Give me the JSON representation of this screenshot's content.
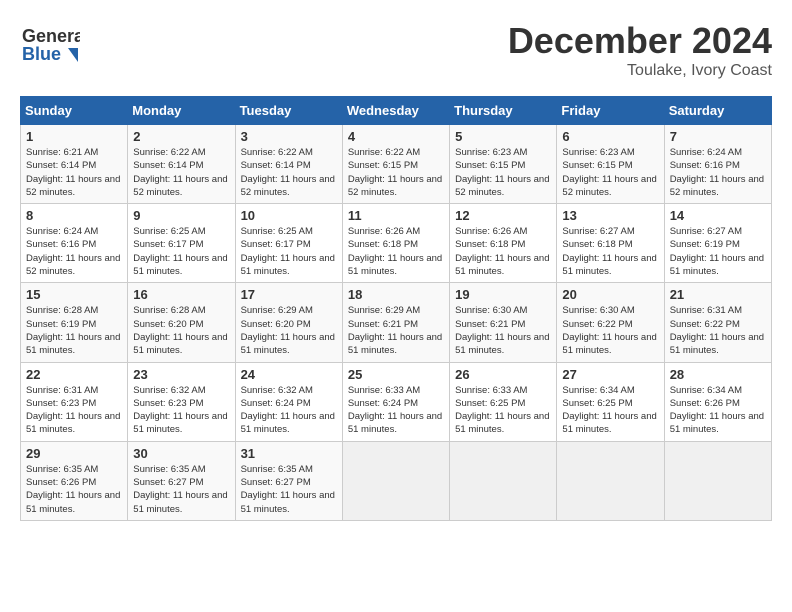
{
  "header": {
    "logo_line1": "General",
    "logo_line2": "Blue",
    "title": "December 2024",
    "subtitle": "Toulake, Ivory Coast"
  },
  "calendar": {
    "days_of_week": [
      "Sunday",
      "Monday",
      "Tuesday",
      "Wednesday",
      "Thursday",
      "Friday",
      "Saturday"
    ],
    "weeks": [
      [
        {
          "day": "",
          "info": ""
        },
        {
          "day": "2",
          "info": "Sunrise: 6:22 AM\nSunset: 6:14 PM\nDaylight: 11 hours\nand 52 minutes."
        },
        {
          "day": "3",
          "info": "Sunrise: 6:22 AM\nSunset: 6:14 PM\nDaylight: 11 hours\nand 52 minutes."
        },
        {
          "day": "4",
          "info": "Sunrise: 6:22 AM\nSunset: 6:15 PM\nDaylight: 11 hours\nand 52 minutes."
        },
        {
          "day": "5",
          "info": "Sunrise: 6:23 AM\nSunset: 6:15 PM\nDaylight: 11 hours\nand 52 minutes."
        },
        {
          "day": "6",
          "info": "Sunrise: 6:23 AM\nSunset: 6:15 PM\nDaylight: 11 hours\nand 52 minutes."
        },
        {
          "day": "7",
          "info": "Sunrise: 6:24 AM\nSunset: 6:16 PM\nDaylight: 11 hours\nand 52 minutes."
        }
      ],
      [
        {
          "day": "1",
          "info": "Sunrise: 6:21 AM\nSunset: 6:14 PM\nDaylight: 11 hours\nand 52 minutes."
        },
        {
          "day": "",
          "info": ""
        },
        {
          "day": "",
          "info": ""
        },
        {
          "day": "",
          "info": ""
        },
        {
          "day": "",
          "info": ""
        },
        {
          "day": "",
          "info": ""
        },
        {
          "day": ""
        }
      ],
      [
        {
          "day": "8",
          "info": "Sunrise: 6:24 AM\nSunset: 6:16 PM\nDaylight: 11 hours\nand 52 minutes."
        },
        {
          "day": "9",
          "info": "Sunrise: 6:25 AM\nSunset: 6:17 PM\nDaylight: 11 hours\nand 51 minutes."
        },
        {
          "day": "10",
          "info": "Sunrise: 6:25 AM\nSunset: 6:17 PM\nDaylight: 11 hours\nand 51 minutes."
        },
        {
          "day": "11",
          "info": "Sunrise: 6:26 AM\nSunset: 6:18 PM\nDaylight: 11 hours\nand 51 minutes."
        },
        {
          "day": "12",
          "info": "Sunrise: 6:26 AM\nSunset: 6:18 PM\nDaylight: 11 hours\nand 51 minutes."
        },
        {
          "day": "13",
          "info": "Sunrise: 6:27 AM\nSunset: 6:18 PM\nDaylight: 11 hours\nand 51 minutes."
        },
        {
          "day": "14",
          "info": "Sunrise: 6:27 AM\nSunset: 6:19 PM\nDaylight: 11 hours\nand 51 minutes."
        }
      ],
      [
        {
          "day": "15",
          "info": "Sunrise: 6:28 AM\nSunset: 6:19 PM\nDaylight: 11 hours\nand 51 minutes."
        },
        {
          "day": "16",
          "info": "Sunrise: 6:28 AM\nSunset: 6:20 PM\nDaylight: 11 hours\nand 51 minutes."
        },
        {
          "day": "17",
          "info": "Sunrise: 6:29 AM\nSunset: 6:20 PM\nDaylight: 11 hours\nand 51 minutes."
        },
        {
          "day": "18",
          "info": "Sunrise: 6:29 AM\nSunset: 6:21 PM\nDaylight: 11 hours\nand 51 minutes."
        },
        {
          "day": "19",
          "info": "Sunrise: 6:30 AM\nSunset: 6:21 PM\nDaylight: 11 hours\nand 51 minutes."
        },
        {
          "day": "20",
          "info": "Sunrise: 6:30 AM\nSunset: 6:22 PM\nDaylight: 11 hours\nand 51 minutes."
        },
        {
          "day": "21",
          "info": "Sunrise: 6:31 AM\nSunset: 6:22 PM\nDaylight: 11 hours\nand 51 minutes."
        }
      ],
      [
        {
          "day": "22",
          "info": "Sunrise: 6:31 AM\nSunset: 6:23 PM\nDaylight: 11 hours\nand 51 minutes."
        },
        {
          "day": "23",
          "info": "Sunrise: 6:32 AM\nSunset: 6:23 PM\nDaylight: 11 hours\nand 51 minutes."
        },
        {
          "day": "24",
          "info": "Sunrise: 6:32 AM\nSunset: 6:24 PM\nDaylight: 11 hours\nand 51 minutes."
        },
        {
          "day": "25",
          "info": "Sunrise: 6:33 AM\nSunset: 6:24 PM\nDaylight: 11 hours\nand 51 minutes."
        },
        {
          "day": "26",
          "info": "Sunrise: 6:33 AM\nSunset: 6:25 PM\nDaylight: 11 hours\nand 51 minutes."
        },
        {
          "day": "27",
          "info": "Sunrise: 6:34 AM\nSunset: 6:25 PM\nDaylight: 11 hours\nand 51 minutes."
        },
        {
          "day": "28",
          "info": "Sunrise: 6:34 AM\nSunset: 6:26 PM\nDaylight: 11 hours\nand 51 minutes."
        }
      ],
      [
        {
          "day": "29",
          "info": "Sunrise: 6:35 AM\nSunset: 6:26 PM\nDaylight: 11 hours\nand 51 minutes."
        },
        {
          "day": "30",
          "info": "Sunrise: 6:35 AM\nSunset: 6:27 PM\nDaylight: 11 hours\nand 51 minutes."
        },
        {
          "day": "31",
          "info": "Sunrise: 6:35 AM\nSunset: 6:27 PM\nDaylight: 11 hours\nand 51 minutes."
        },
        {
          "day": "",
          "info": ""
        },
        {
          "day": "",
          "info": ""
        },
        {
          "day": "",
          "info": ""
        },
        {
          "day": "",
          "info": ""
        }
      ]
    ]
  }
}
